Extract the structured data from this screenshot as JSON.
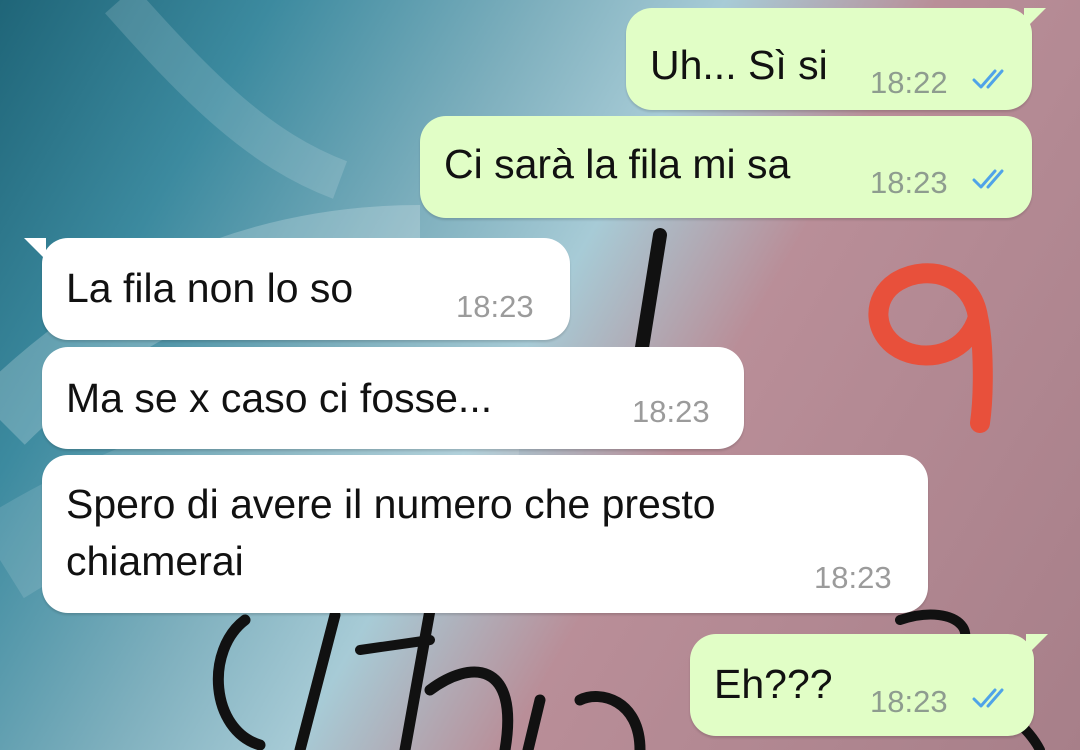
{
  "chat": {
    "messages": [
      {
        "direction": "outgoing",
        "text": "Uh... Sì si",
        "time": "18:22",
        "status": "read"
      },
      {
        "direction": "outgoing",
        "text": "Ci sarà la fila mi sa",
        "time": "18:23",
        "status": "read"
      },
      {
        "direction": "incoming",
        "text": "La fila non lo so",
        "time": "18:23"
      },
      {
        "direction": "incoming",
        "text": "Ma se x caso ci fosse...",
        "time": "18:23"
      },
      {
        "direction": "incoming",
        "text_line1": "Spero di avere il numero che presto",
        "text_line2": "chiamerai",
        "time": "18:23"
      },
      {
        "direction": "outgoing",
        "text": "Eh???",
        "time": "18:23",
        "status": "read"
      }
    ]
  },
  "colors": {
    "outgoing_bubble": "#e1fec6",
    "incoming_bubble": "#ffffff",
    "read_ticks": "#4fa3e8",
    "annotation": "#e8503b"
  },
  "icons": {
    "read_status": "double-check-icon"
  }
}
